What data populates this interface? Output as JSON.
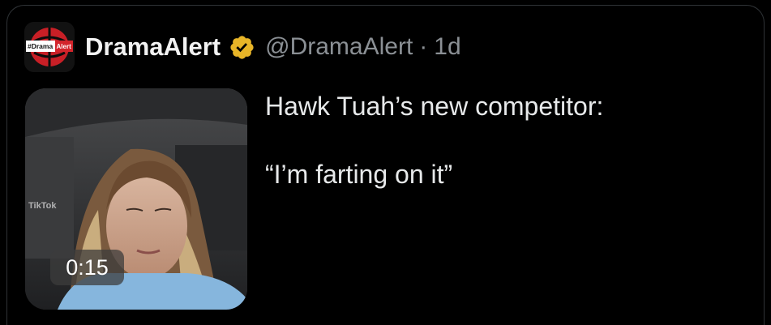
{
  "post": {
    "author": {
      "display_name": "DramaAlert",
      "handle": "@DramaAlert",
      "verified": true,
      "avatar_text_left": "#Drama",
      "avatar_text_right": "Alert"
    },
    "separator": "·",
    "time": "1d",
    "text_lines": [
      "Hawk Tuah’s new competitor:",
      "“I’m farting on it”"
    ],
    "media": {
      "type": "video",
      "duration": "0:15",
      "watermark": "TikTok"
    }
  },
  "colors": {
    "background": "#000000",
    "text_primary": "#e7e9ea",
    "text_secondary": "#8b9095",
    "verified_gold": "#e8b528",
    "avatar_red": "#d3242b"
  }
}
